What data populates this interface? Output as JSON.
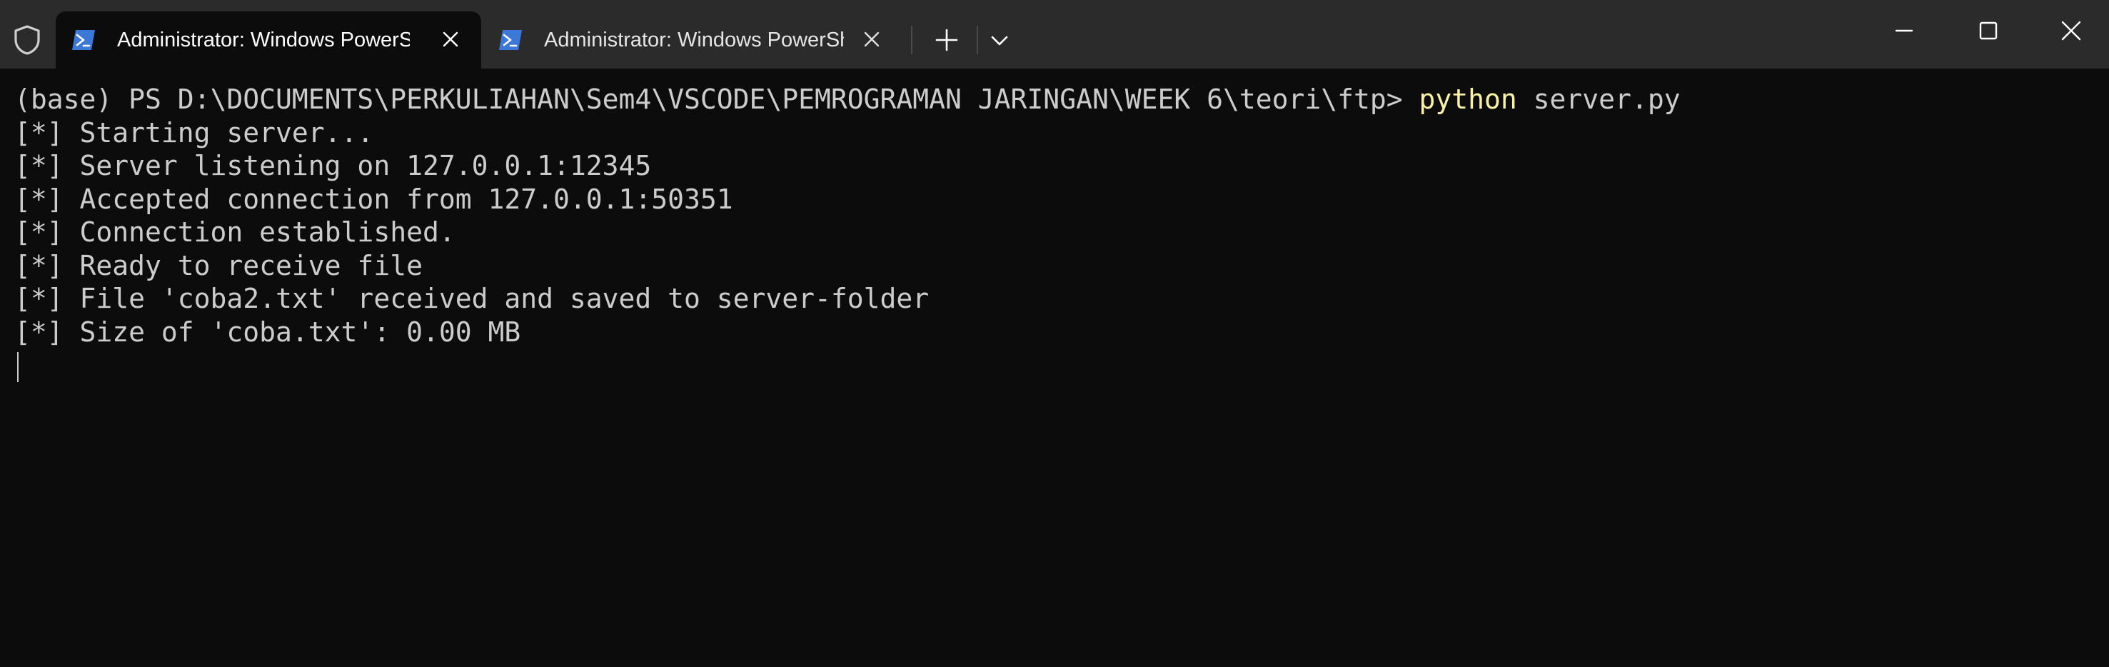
{
  "tabs": [
    {
      "title": "Administrator: Windows PowerShell",
      "active": true
    },
    {
      "title": "Administrator: Windows PowerShell",
      "active": false
    }
  ],
  "terminal": {
    "prompt": "(base) PS D:\\DOCUMENTS\\PERKULIAHAN\\Sem4\\VSCODE\\PEMROGRAMAN JARINGAN\\WEEK 6\\teori\\ftp> ",
    "command": "python",
    "command_args": " server.py",
    "lines": [
      "[*] Starting server...",
      "[*] Server listening on 127.0.0.1:12345",
      "[*] Accepted connection from 127.0.0.1:50351",
      "[*] Connection established.",
      "[*] Ready to receive file",
      "[*] File 'coba2.txt' received and saved to server-folder",
      "[*] Size of 'coba.txt': 0.00 MB"
    ]
  },
  "colors": {
    "background": "#0c0c0c",
    "titlebar": "#2b2b2b",
    "text": "#cccccc",
    "command": "#f9f1a5",
    "powershell_icon": "#3b78d8"
  },
  "icons": {
    "shield": "shield-icon",
    "tab": "powershell-icon",
    "tab_close": "close-icon",
    "new_tab": "plus-icon",
    "dropdown": "chevron-down-icon",
    "minimize": "minimize-icon",
    "maximize": "maximize-icon",
    "close": "close-icon"
  }
}
